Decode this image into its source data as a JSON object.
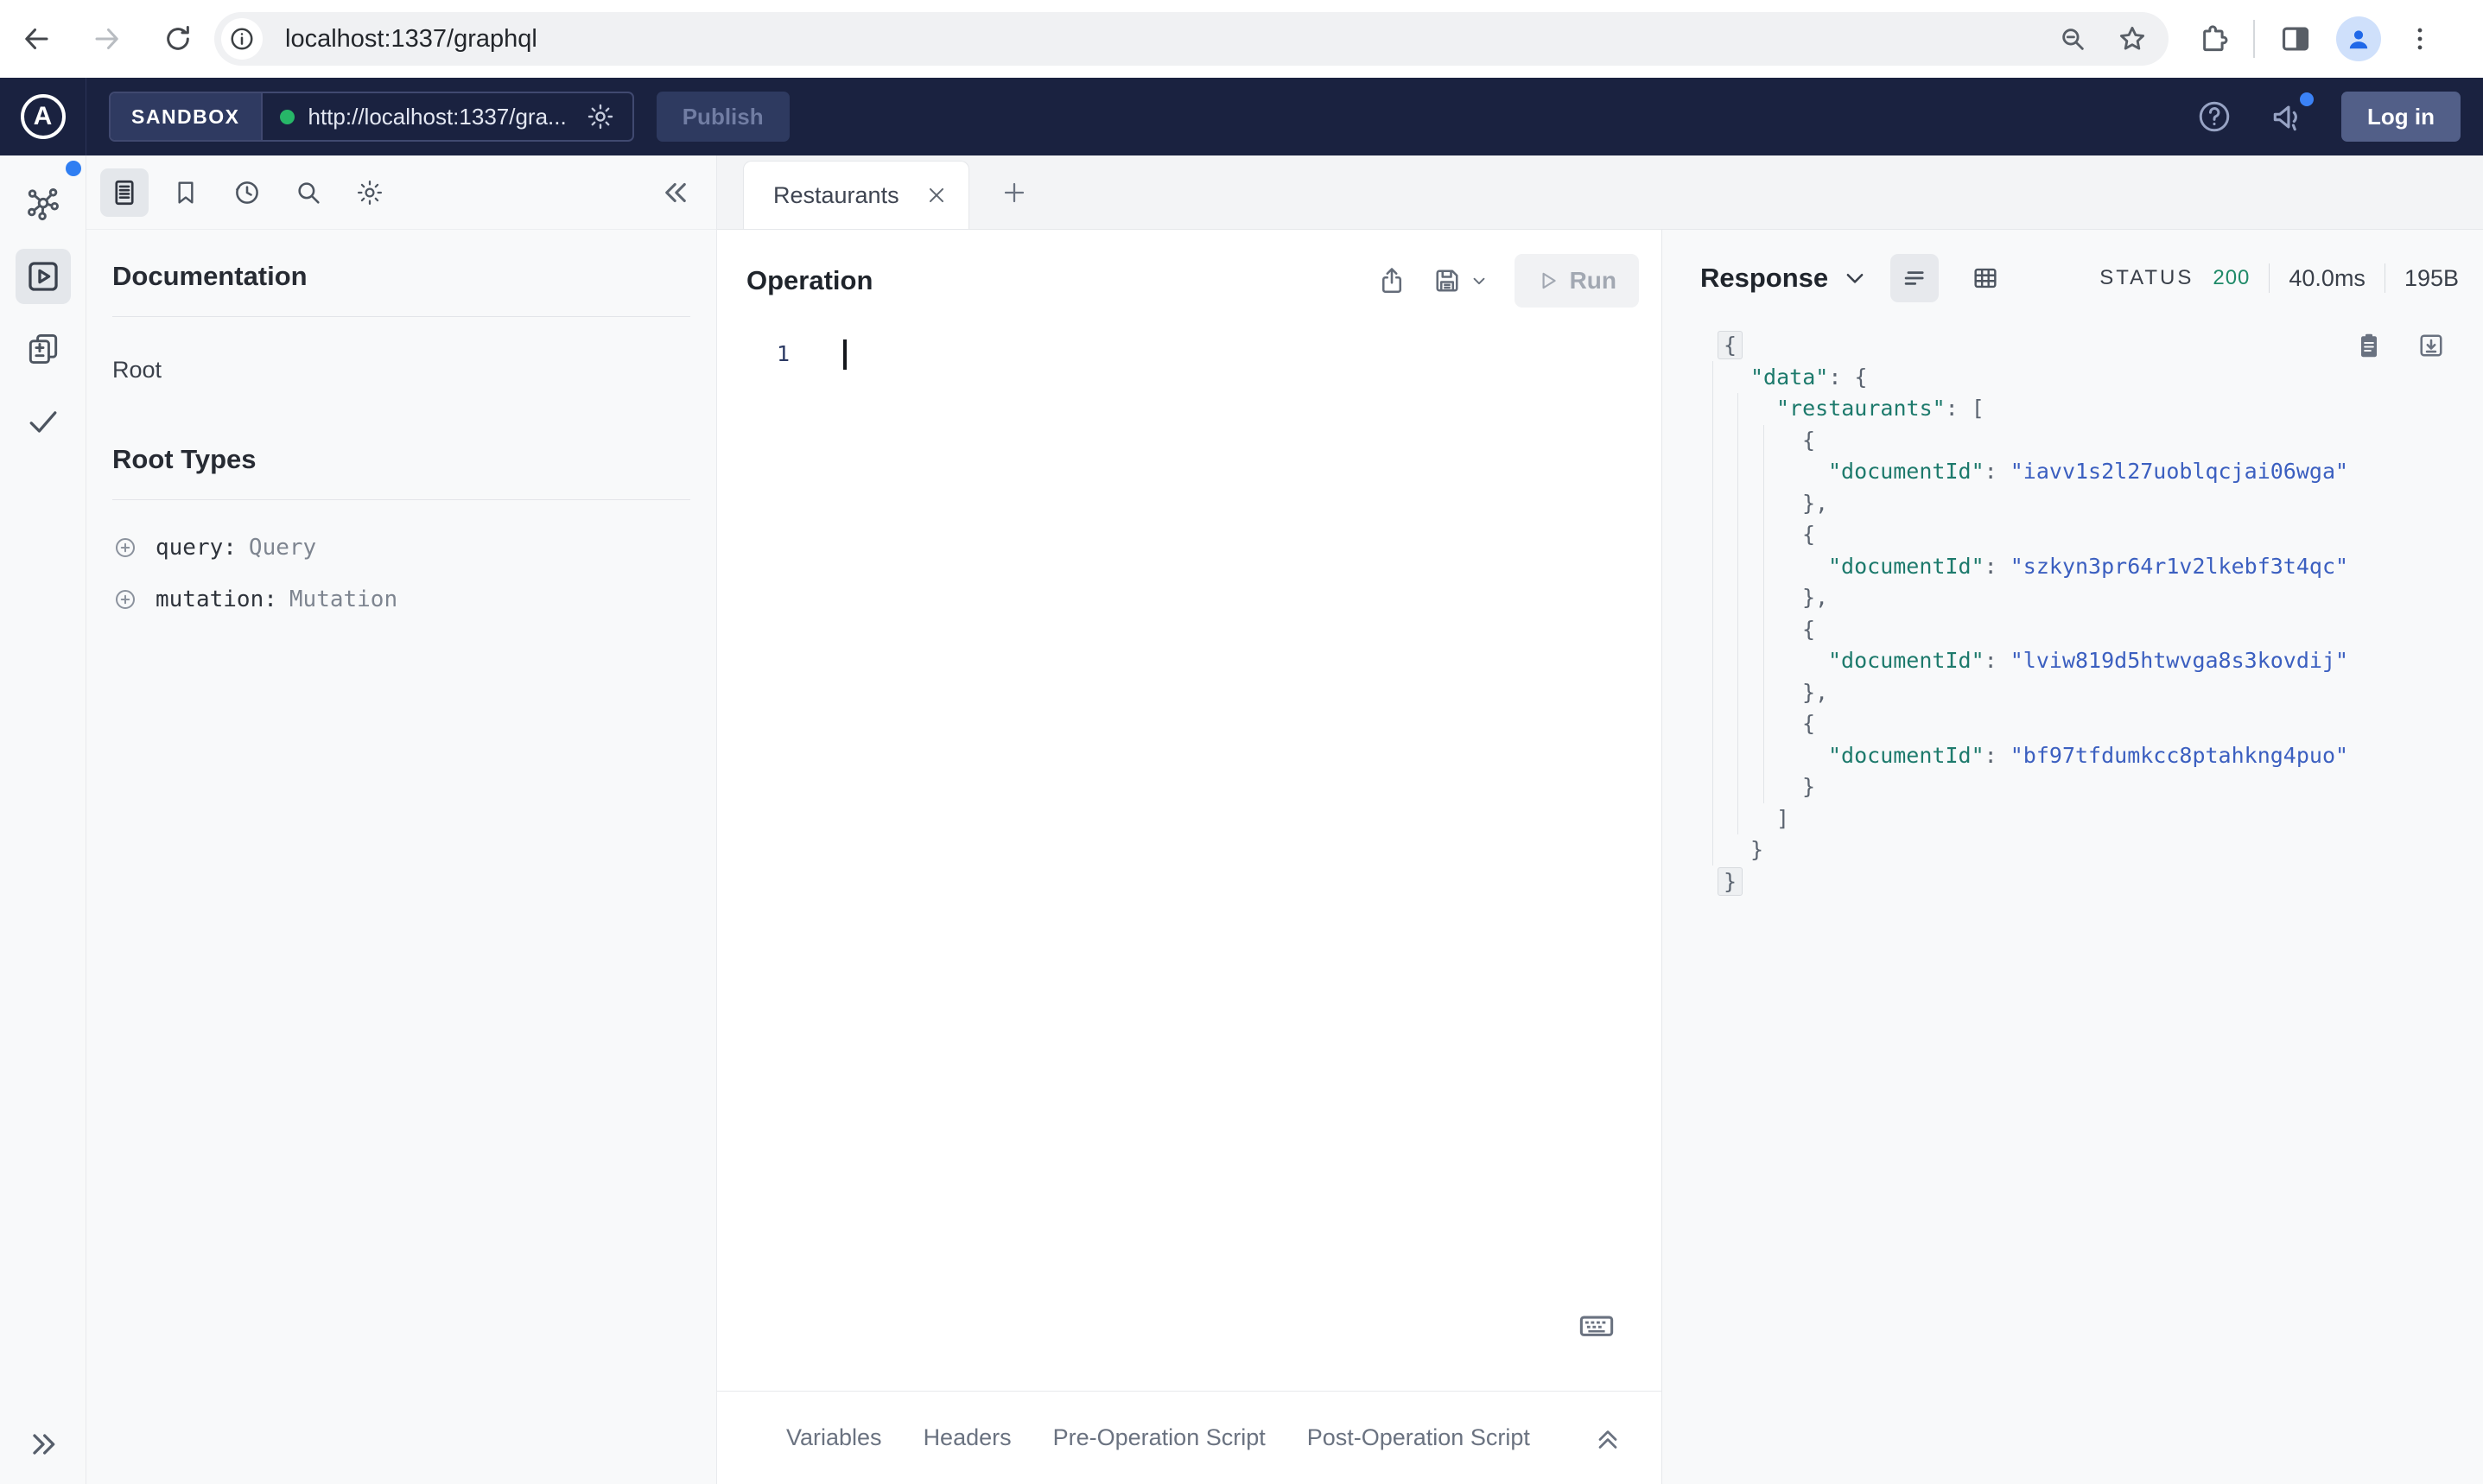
{
  "browser": {
    "url": "localhost:1337/graphql"
  },
  "header": {
    "logo_letter": "A",
    "sandbox_label": "SANDBOX",
    "endpoint_url": "http://localhost:1337/gra...",
    "publish_label": "Publish",
    "login_label": "Log in"
  },
  "docs": {
    "title": "Documentation",
    "root_link": "Root",
    "root_types_title": "Root Types",
    "fields": [
      {
        "name": "query:",
        "type": "Query"
      },
      {
        "name": "mutation:",
        "type": "Mutation"
      }
    ]
  },
  "tabs": {
    "active_label": "Restaurants"
  },
  "operation": {
    "title": "Operation",
    "run_label": "Run",
    "line_number": "1"
  },
  "response": {
    "title": "Response",
    "status_label": "STATUS",
    "status_code": "200",
    "time": "40.0ms",
    "size": "195B",
    "lines": [
      {
        "ind": 0,
        "tok": [
          {
            "c": "p",
            "t": "{",
            "fold": true
          }
        ]
      },
      {
        "ind": 1,
        "tok": [
          {
            "c": "k",
            "t": "\"data\""
          },
          {
            "c": "p",
            "t": ": {"
          }
        ]
      },
      {
        "ind": 2,
        "tok": [
          {
            "c": "k",
            "t": "\"restaurants\""
          },
          {
            "c": "p",
            "t": ": ["
          }
        ]
      },
      {
        "ind": 3,
        "tok": [
          {
            "c": "p",
            "t": "{"
          }
        ]
      },
      {
        "ind": 4,
        "tok": [
          {
            "c": "k",
            "t": "\"documentId\""
          },
          {
            "c": "p",
            "t": ": "
          },
          {
            "c": "v",
            "t": "\"iavv1s2l27uoblqcjai06wga\""
          }
        ]
      },
      {
        "ind": 3,
        "tok": [
          {
            "c": "p",
            "t": "},"
          }
        ]
      },
      {
        "ind": 3,
        "tok": [
          {
            "c": "p",
            "t": "{"
          }
        ]
      },
      {
        "ind": 4,
        "tok": [
          {
            "c": "k",
            "t": "\"documentId\""
          },
          {
            "c": "p",
            "t": ": "
          },
          {
            "c": "v",
            "t": "\"szkyn3pr64r1v2lkebf3t4qc\""
          }
        ]
      },
      {
        "ind": 3,
        "tok": [
          {
            "c": "p",
            "t": "},"
          }
        ]
      },
      {
        "ind": 3,
        "tok": [
          {
            "c": "p",
            "t": "{"
          }
        ]
      },
      {
        "ind": 4,
        "tok": [
          {
            "c": "k",
            "t": "\"documentId\""
          },
          {
            "c": "p",
            "t": ": "
          },
          {
            "c": "v",
            "t": "\"lviw819d5htwvga8s3kovdij\""
          }
        ]
      },
      {
        "ind": 3,
        "tok": [
          {
            "c": "p",
            "t": "},"
          }
        ]
      },
      {
        "ind": 3,
        "tok": [
          {
            "c": "p",
            "t": "{"
          }
        ]
      },
      {
        "ind": 4,
        "tok": [
          {
            "c": "k",
            "t": "\"documentId\""
          },
          {
            "c": "p",
            "t": ": "
          },
          {
            "c": "v",
            "t": "\"bf97tfdumkcc8ptahkng4puo\""
          }
        ]
      },
      {
        "ind": 3,
        "tok": [
          {
            "c": "p",
            "t": "}"
          }
        ]
      },
      {
        "ind": 2,
        "tok": [
          {
            "c": "p",
            "t": "]"
          }
        ]
      },
      {
        "ind": 1,
        "tok": [
          {
            "c": "p",
            "t": "}"
          }
        ]
      },
      {
        "ind": 0,
        "tok": [
          {
            "c": "p",
            "t": "}",
            "fold": true
          }
        ]
      }
    ]
  },
  "bottom_bar": {
    "tabs": [
      "Variables",
      "Headers",
      "Pre-Operation Script",
      "Post-Operation Script"
    ]
  },
  "colors": {
    "header_navy": "#1a2240",
    "status_green": "#1f8a68",
    "json_key_teal": "#1d7a6c",
    "json_value_blue": "#3b5fc0",
    "endpoint_dot_green": "#27b768",
    "notification_blue": "#2f7ef2",
    "panel_gray": "#f8f9fa"
  }
}
